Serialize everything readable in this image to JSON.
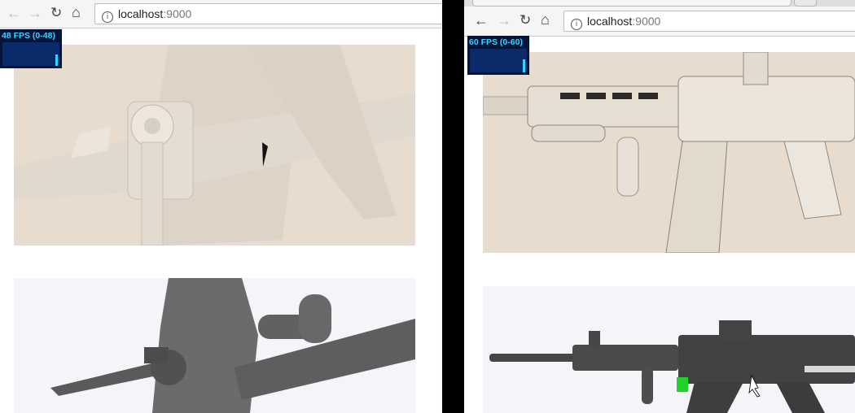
{
  "left_window": {
    "address": {
      "host": "localhost",
      "port": ":9000"
    },
    "fps": {
      "label": "48 FPS (0-48)",
      "level": 1.0
    }
  },
  "right_window": {
    "address": {
      "host": "localhost",
      "port": ":9000"
    },
    "fps": {
      "label": "60 FPS (0-60)",
      "level": 1.0
    }
  },
  "icons": {
    "back": "arrow-left-icon",
    "forward": "arrow-right-icon",
    "reload": "reload-icon",
    "home": "home-icon",
    "info": "info-icon"
  },
  "colors": {
    "fps_text": "#2fd6ff",
    "fps_bg": "#07143a",
    "render_bg_beige": "#e8dccd",
    "model_grey": "#5e5e5e",
    "accent_green": "#22d12a"
  }
}
